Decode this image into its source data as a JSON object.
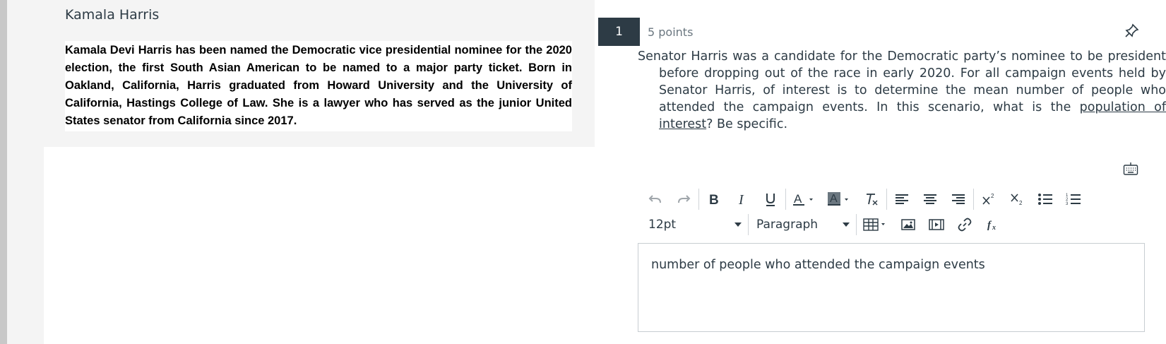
{
  "passage": {
    "title": "Kamala Harris",
    "body": "Kamala Devi Harris has been named the Democratic vice presidential nominee for the 2020 election, the first South Asian American to be named to a major party ticket. Born in Oakland, California, Harris graduated from Howard University and the University of California, Hastings College of Law. She is a lawyer who has served as the junior United States senator from California since 2017."
  },
  "question": {
    "number": "1",
    "points": "5 points",
    "text_before": "Senator Harris was a candidate for the Democratic party’s nominee to be president before dropping out of the race in early 2020. For all campaign events held by Senator Harris, of interest is to determine the mean number of people who attended the campaign events. In this scenario, what is the ",
    "text_underlined": "population of interest",
    "text_after": "? Be specific."
  },
  "editor": {
    "font_size": "12pt",
    "block_format": "Paragraph",
    "content": "number of people who attended the campaign events"
  },
  "icons": {
    "pin": "pin-icon",
    "keyboard": "keyboard-icon",
    "toolbar": [
      "undo-icon",
      "redo-icon",
      "bold-icon",
      "italic-icon",
      "underline-icon",
      "text-color-icon",
      "background-color-icon",
      "clear-formatting-icon",
      "align-left-icon",
      "align-center-icon",
      "align-right-icon",
      "superscript-icon",
      "subscript-icon",
      "bulleted-list-icon",
      "numbered-list-icon",
      "table-icon",
      "image-icon",
      "media-icon",
      "link-icon",
      "equation-icon"
    ]
  },
  "colors": {
    "question_badge": "#2d3b45",
    "text": "#2d3b45",
    "panel_bg": "#f4f4f4"
  }
}
